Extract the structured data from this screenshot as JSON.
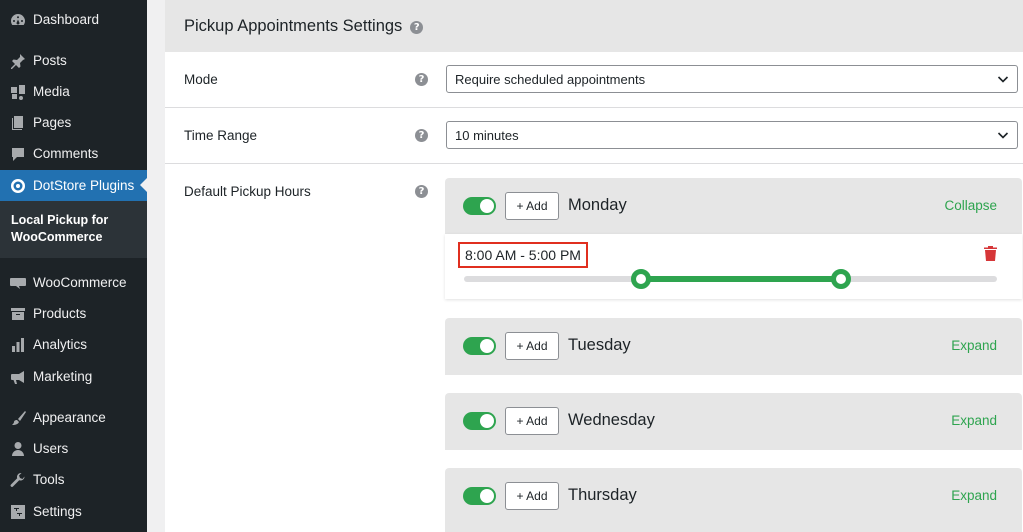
{
  "sidebar": {
    "items": [
      {
        "label": "Dashboard",
        "icon": "dashboard-icon"
      },
      {
        "label": "Posts",
        "icon": "pin-icon"
      },
      {
        "label": "Media",
        "icon": "media-icon"
      },
      {
        "label": "Pages",
        "icon": "pages-icon"
      },
      {
        "label": "Comments",
        "icon": "comment-icon"
      },
      {
        "label": "DotStore Plugins",
        "icon": "dotstore-icon"
      },
      {
        "label": "WooCommerce",
        "icon": "woo-icon"
      },
      {
        "label": "Products",
        "icon": "archive-icon"
      },
      {
        "label": "Analytics",
        "icon": "chart-icon"
      },
      {
        "label": "Marketing",
        "icon": "megaphone-icon"
      },
      {
        "label": "Appearance",
        "icon": "brush-icon"
      },
      {
        "label": "Users",
        "icon": "user-icon"
      },
      {
        "label": "Tools",
        "icon": "wrench-icon"
      },
      {
        "label": "Settings",
        "icon": "settings-icon"
      }
    ],
    "submenu": "Local Pickup for WooCommerce"
  },
  "panel": {
    "title": "Pickup Appointments Settings",
    "help": "?"
  },
  "mode": {
    "label": "Mode",
    "value": "Require scheduled appointments"
  },
  "time_range": {
    "label": "Time Range",
    "value": "10 minutes"
  },
  "pickup_hours": {
    "label": "Default Pickup Hours"
  },
  "add_label": "+ Add",
  "days": [
    {
      "name": "Monday",
      "action": "Collapse",
      "enabled": true
    },
    {
      "name": "Tuesday",
      "action": "Expand",
      "enabled": true
    },
    {
      "name": "Wednesday",
      "action": "Expand",
      "enabled": true
    },
    {
      "name": "Thursday",
      "action": "Expand",
      "enabled": true
    }
  ],
  "monday_slot": {
    "time": "8:00 AM - 5:00 PM",
    "range_start_fraction": 0.333,
    "range_end_fraction": 0.708
  },
  "colors": {
    "sidebar_bg": "#1d2327",
    "active_bg": "#2271b1",
    "green": "#2ea44f",
    "highlight_red": "#e02f1f",
    "trash_red": "#d63638"
  }
}
